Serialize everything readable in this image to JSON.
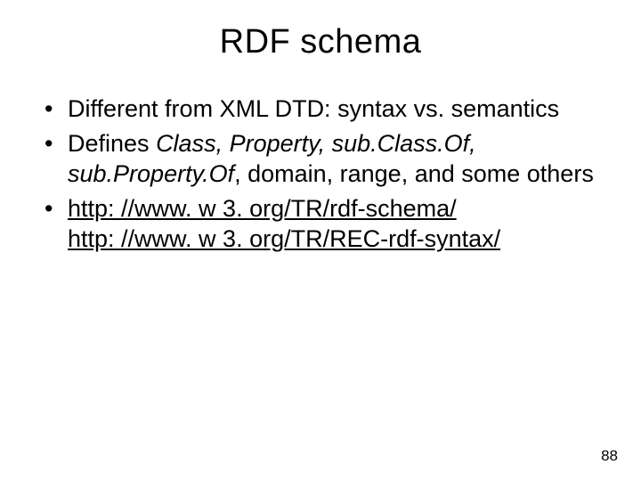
{
  "title": "RDF schema",
  "bullets": {
    "b1": "Different from XML DTD: syntax vs. semantics",
    "b2": {
      "lead": "Defines ",
      "italic": "Class, Property, sub.Class.Of, sub.Property.Of",
      "tail": ", domain, range, and some others"
    },
    "b3": {
      "link1": "http: //www. w 3. org/TR/rdf-schema/",
      "link2": "http: //www. w 3. org/TR/REC-rdf-syntax/"
    }
  },
  "page_number": "88"
}
